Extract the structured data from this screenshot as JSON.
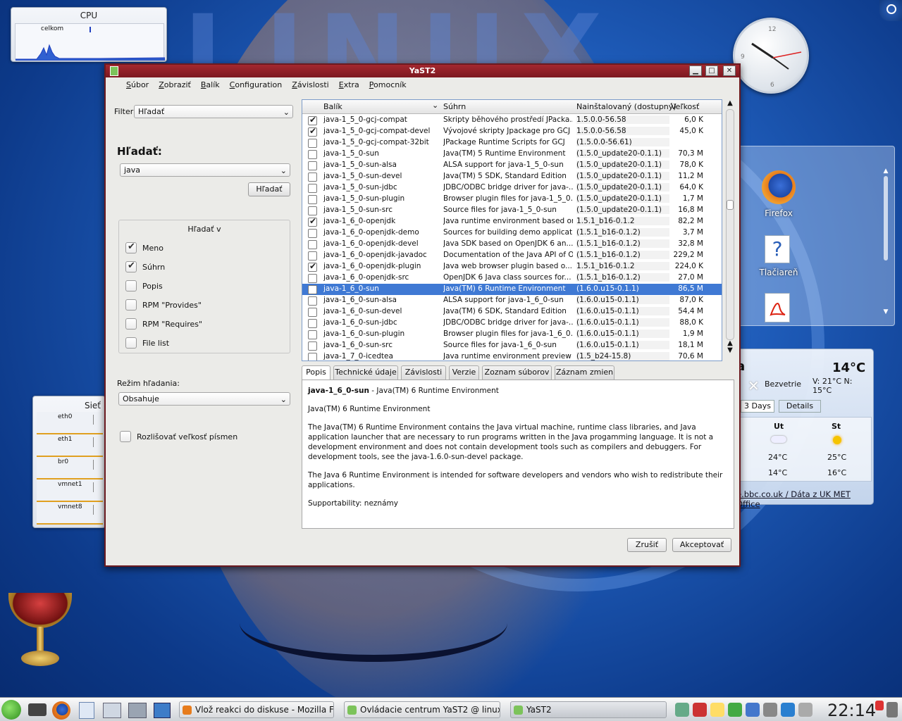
{
  "desktop": {
    "cpu_widget": {
      "title": "CPU",
      "label": "celkom"
    },
    "network_widget": {
      "title": "Sieť",
      "interfaces": [
        "eth0",
        "eth1",
        "br0",
        "vmnet1",
        "vmnet8"
      ]
    },
    "icons": {
      "firefox": "Firefox",
      "printer": "Tlačiareň"
    },
    "weather": {
      "city_suffix": "a",
      "temperature": "14°C",
      "condition": "Bezvetrie",
      "range": "V: 21°C N: 15°C",
      "tab_days": "3 Days",
      "tab_details": "Details",
      "days": [
        {
          "name": "Ut",
          "icon": "cloud-icon",
          "high": "24°C",
          "low": "14°C"
        },
        {
          "name": "St",
          "icon": "sun-icon",
          "high": "25°C",
          "low": "16°C"
        }
      ],
      "source": "e.bbc.co.uk / Dáta z UK MET Office"
    }
  },
  "window": {
    "title": "YaST2",
    "menu": [
      "Súbor",
      "Zobraziť",
      "Balík",
      "Configuration",
      "Závislosti",
      "Extra",
      "Pomocník"
    ],
    "filter": {
      "label": "Filter:",
      "value": "Hľadať"
    },
    "search": {
      "heading": "Hľadať:",
      "value": "java",
      "button": "Hľadať",
      "search_in_title": "Hľadať v",
      "options": [
        {
          "label": "Meno",
          "checked": true
        },
        {
          "label": "Súhrn",
          "checked": true
        },
        {
          "label": "Popis",
          "checked": false
        },
        {
          "label": "RPM \"Provides\"",
          "checked": false
        },
        {
          "label": "RPM \"Requires\"",
          "checked": false
        },
        {
          "label": "File list",
          "checked": false
        }
      ],
      "mode_label": "Režim hľadania:",
      "mode_value": "Obsahuje",
      "case_label": "Rozlišovať veľkosť písmen"
    },
    "table": {
      "headers": {
        "package": "Balík",
        "summary": "Súhrn",
        "installed": "Nainštalovaný (dostupný)",
        "size": "Veľkosť"
      },
      "rows": [
        {
          "checked": true,
          "name": "java-1_5_0-gcj-compat",
          "summary": "Skripty běhového prostředí JPacka...",
          "version": "1.5.0.0-56.58",
          "size": "6,0 K"
        },
        {
          "checked": true,
          "name": "java-1_5_0-gcj-compat-devel",
          "summary": "Vývojové skripty Jpackage pro GCJ",
          "version": "1.5.0.0-56.58",
          "size": "45,0 K"
        },
        {
          "checked": false,
          "name": "java-1_5_0-gcj-compat-32bit",
          "summary": "JPackage Runtime Scripts for GCJ",
          "version": "(1.5.0.0-56.61)",
          "size": ""
        },
        {
          "checked": false,
          "name": "java-1_5_0-sun",
          "summary": "Java(TM) 5 Runtime Environment",
          "version": "(1.5.0_update20-0.1.1)",
          "size": "70,3 M"
        },
        {
          "checked": false,
          "name": "java-1_5_0-sun-alsa",
          "summary": "ALSA support for java-1_5_0-sun",
          "version": "(1.5.0_update20-0.1.1)",
          "size": "78,0 K"
        },
        {
          "checked": false,
          "name": "java-1_5_0-sun-devel",
          "summary": "Java(TM) 5 SDK, Standard Edition",
          "version": "(1.5.0_update20-0.1.1)",
          "size": "11,2 M"
        },
        {
          "checked": false,
          "name": "java-1_5_0-sun-jdbc",
          "summary": "JDBC/ODBC bridge driver for java-...",
          "version": "(1.5.0_update20-0.1.1)",
          "size": "64,0 K"
        },
        {
          "checked": false,
          "name": "java-1_5_0-sun-plugin",
          "summary": "Browser plugin files for java-1_5_0...",
          "version": "(1.5.0_update20-0.1.1)",
          "size": "1,7 M"
        },
        {
          "checked": false,
          "name": "java-1_5_0-sun-src",
          "summary": "Source files for java-1_5_0-sun",
          "version": "(1.5.0_update20-0.1.1)",
          "size": "16,8 M"
        },
        {
          "checked": true,
          "name": "java-1_6_0-openjdk",
          "summary": "Java runtime environment based on...",
          "version": "1.5.1_b16-0.1.2",
          "size": "82,2 M"
        },
        {
          "checked": false,
          "name": "java-1_6_0-openjdk-demo",
          "summary": "Sources for building demo applicati...",
          "version": "(1.5.1_b16-0.1.2)",
          "size": "3,7 M"
        },
        {
          "checked": false,
          "name": "java-1_6_0-openjdk-devel",
          "summary": "Java SDK based on OpenJDK 6 an...",
          "version": "(1.5.1_b16-0.1.2)",
          "size": "32,8 M"
        },
        {
          "checked": false,
          "name": "java-1_6_0-openjdk-javadoc",
          "summary": "Documentation of the Java API of O...",
          "version": "(1.5.1_b16-0.1.2)",
          "size": "229,2 M"
        },
        {
          "checked": true,
          "name": "java-1_6_0-openjdk-plugin",
          "summary": "Java web browser plugin based o...",
          "version": "1.5.1_b16-0.1.2",
          "size": "224,0 K"
        },
        {
          "checked": false,
          "name": "java-1_6_0-openjdk-src",
          "summary": "OpenJDK 6 Java class sources for...",
          "version": "(1.5.1_b16-0.1.2)",
          "size": "27,0 M"
        },
        {
          "checked": false,
          "name": "java-1_6_0-sun",
          "summary": "Java(TM) 6 Runtime Environment",
          "version": "(1.6.0.u15-0.1.1)",
          "size": "86,5 M",
          "selected": true
        },
        {
          "checked": false,
          "name": "java-1_6_0-sun-alsa",
          "summary": "ALSA support for java-1_6_0-sun",
          "version": "(1.6.0.u15-0.1.1)",
          "size": "87,0 K"
        },
        {
          "checked": false,
          "name": "java-1_6_0-sun-devel",
          "summary": "Java(TM) 6 SDK, Standard Edition",
          "version": "(1.6.0.u15-0.1.1)",
          "size": "54,4 M"
        },
        {
          "checked": false,
          "name": "java-1_6_0-sun-jdbc",
          "summary": "JDBC/ODBC bridge driver for java-...",
          "version": "(1.6.0.u15-0.1.1)",
          "size": "88,0 K"
        },
        {
          "checked": false,
          "name": "java-1_6_0-sun-plugin",
          "summary": "Browser plugin files for java-1_6_0...",
          "version": "(1.6.0.u15-0.1.1)",
          "size": "1,9 M"
        },
        {
          "checked": false,
          "name": "java-1_6_0-sun-src",
          "summary": "Source files for java-1_6_0-sun",
          "version": "(1.6.0.u15-0.1.1)",
          "size": "18,1 M"
        },
        {
          "checked": false,
          "name": "java-1_7_0-icedtea",
          "summary": "Java runtime environment preview ...",
          "version": "(1.5_b24-15.8)",
          "size": "70,6 M"
        }
      ]
    },
    "tabs": [
      "Popis",
      "Technické údaje",
      "Závislosti",
      "Verzie",
      "Zoznam súborov",
      "Záznam zmien"
    ],
    "description": {
      "name": "java-1_6_0-sun",
      "summary": " - Java(TM) 6 Runtime Environment",
      "p1": "Java(TM) 6 Runtime Environment",
      "p2": "The Java(TM) 6 Runtime Environment contains the Java virtual machine, runtime class libraries, and Java application launcher that are necessary to run programs written in the Java progamming language. It is not a development environment and does not contain development tools such as compilers and debuggers. For development tools, see the java-1.6.0-sun-devel package.",
      "p3": "The Java 6 Runtime Environment is intended for software developers and vendors who wish to redistribute their applications.",
      "p4": "Supportability: neznámy"
    },
    "buttons": {
      "cancel": "Zrušiť",
      "accept": "Akceptovať"
    }
  },
  "taskbar": {
    "tasks": [
      {
        "label": "Vlož reakci do diskuse - Mozilla Firef",
        "icon": "firefox-icon"
      },
      {
        "label": "Ovládacie centrum YaST2 @ linux-g",
        "icon": "yast-icon"
      },
      {
        "label": "YaST2",
        "icon": "yast-icon"
      }
    ],
    "clock": "22:14"
  }
}
